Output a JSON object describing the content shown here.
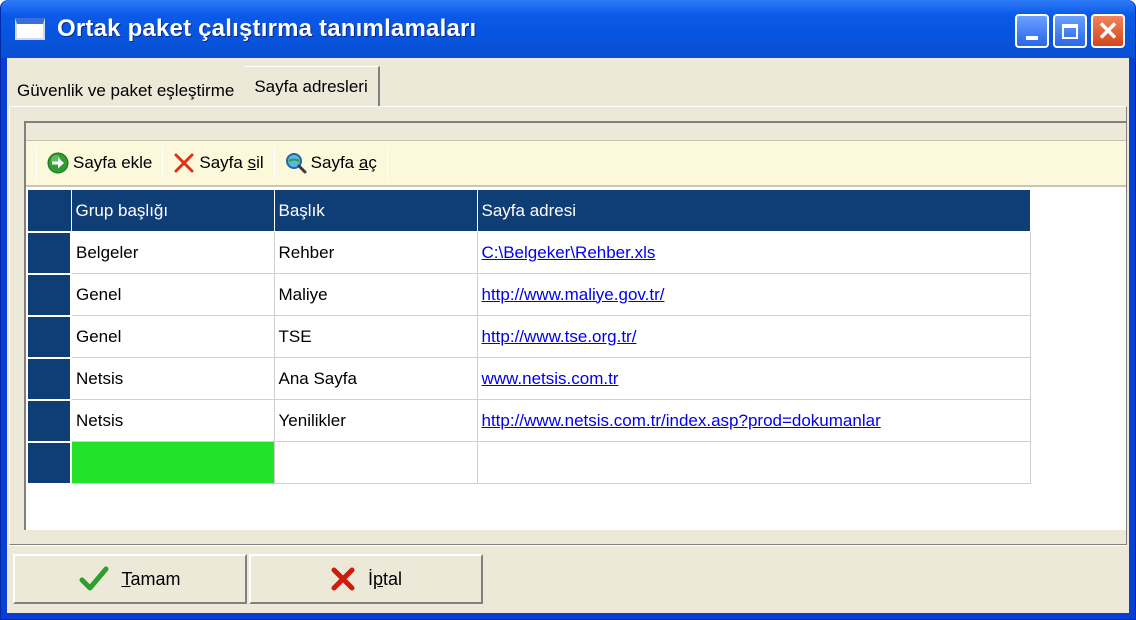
{
  "window": {
    "title": "Ortak paket çalıştırma tanımlamaları"
  },
  "tabs": [
    {
      "label": "Güvenlik ve paket eşleştirme",
      "active": false
    },
    {
      "label": "Sayfa adresleri",
      "active": true
    }
  ],
  "toolbar": {
    "add": {
      "pre": "Sayfa ekle",
      "icon": "green-arrow-icon"
    },
    "delete": {
      "pre": "Sayfa ",
      "accel": "s",
      "post": "il",
      "icon": "red-x-icon"
    },
    "open": {
      "pre": "Sayfa ",
      "accel": "a",
      "post": "ç",
      "icon": "magnifier-globe-icon"
    }
  },
  "grid": {
    "columns": [
      "Grup başlığı",
      "Başlık",
      "Sayfa adresi"
    ],
    "rows": [
      {
        "group": "Belgeler",
        "title": "Rehber",
        "url": "C:\\Belgeker\\Rehber.xls"
      },
      {
        "group": "Genel",
        "title": "Maliye",
        "url": "http://www.maliye.gov.tr/"
      },
      {
        "group": "Genel",
        "title": "TSE",
        "url": "http://www.tse.org.tr/"
      },
      {
        "group": "Netsis",
        "title": "Ana Sayfa",
        "url": "www.netsis.com.tr"
      },
      {
        "group": "Netsis",
        "title": "Yenilikler",
        "url": "http://www.netsis.com.tr/index.asp?prod=dokumanlar"
      }
    ],
    "new_row_color": "#22e32a",
    "header_color": "#0f3d75"
  },
  "buttons": {
    "ok": {
      "accel": "T",
      "post": "amam",
      "icon": "green-check-icon"
    },
    "cancel": {
      "pre": "İ",
      "accel": "p",
      "post": "tal",
      "icon": "red-x-icon"
    }
  }
}
